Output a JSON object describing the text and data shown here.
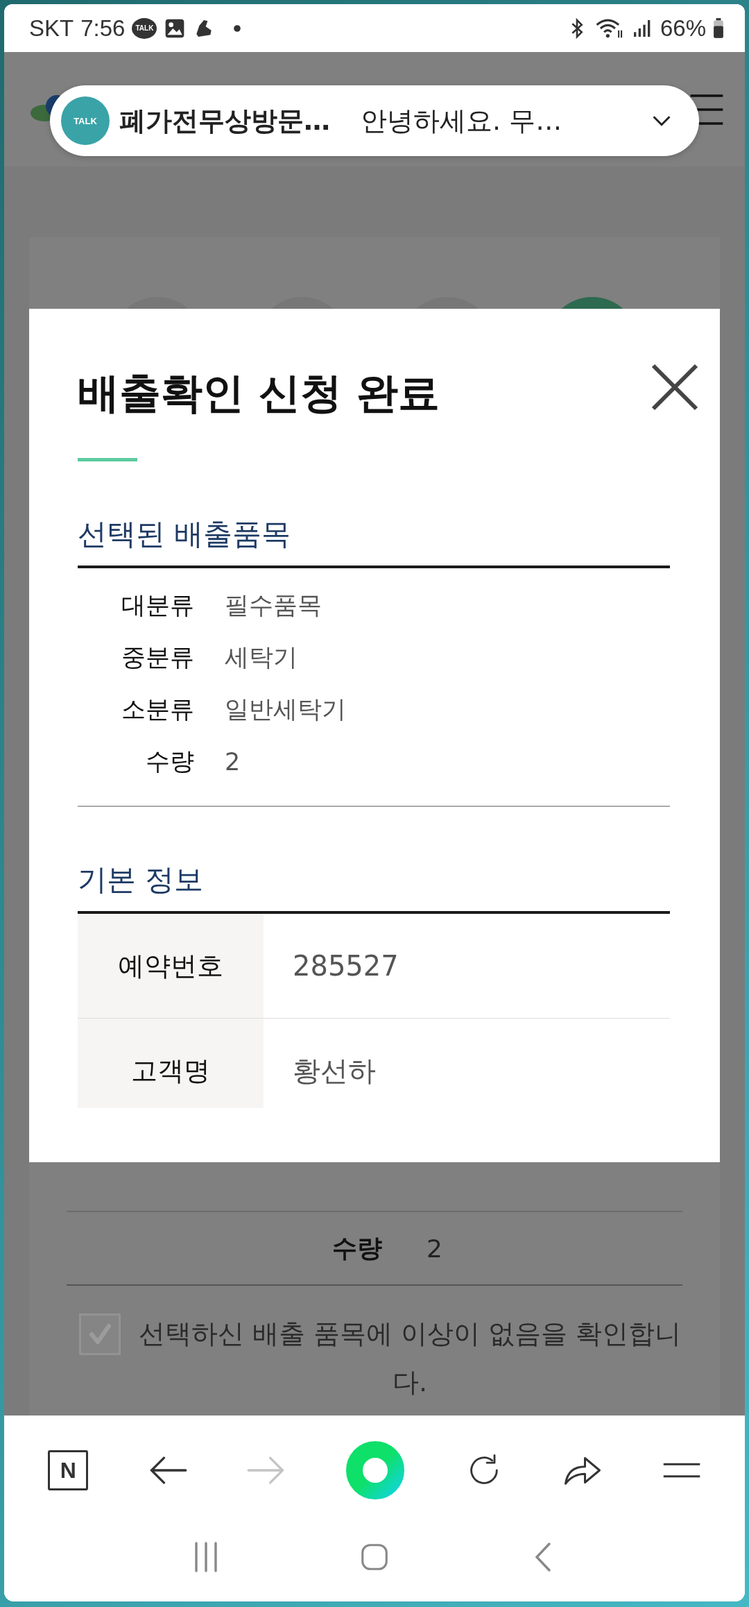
{
  "status_bar": {
    "carrier": "SKT",
    "time": "7:56",
    "talk_icon_text": "TALK",
    "battery": "66%"
  },
  "notification": {
    "icon_text": "TALK",
    "title": "폐가전무상방문…",
    "message": "안녕하세요. 무…"
  },
  "background": {
    "steps": [
      {
        "selected": false
      },
      {
        "selected": false
      },
      {
        "selected": false
      },
      {
        "selected": true
      }
    ],
    "rows": [
      {
        "label": "수량",
        "value": "2"
      }
    ],
    "confirm": {
      "checked": true,
      "text": "선택하신 배출 품목에 이상이 없음을 확인합니다."
    }
  },
  "modal": {
    "title": "배출확인 신청 완료",
    "items_section": {
      "heading": "선택된 배출품목",
      "rows": [
        {
          "label": "대분류",
          "value": "필수품목"
        },
        {
          "label": "중분류",
          "value": "세탁기"
        },
        {
          "label": "소분류",
          "value": "일반세탁기"
        },
        {
          "label": "수량",
          "value": "2"
        }
      ]
    },
    "info_section": {
      "heading": "기본 정보",
      "rows": [
        {
          "label": "예약번호",
          "value": "285527"
        },
        {
          "label": "고객명",
          "value": "황선하"
        }
      ]
    }
  },
  "browser_toolbar": {
    "home_letter": "N",
    "forward_disabled": true
  }
}
